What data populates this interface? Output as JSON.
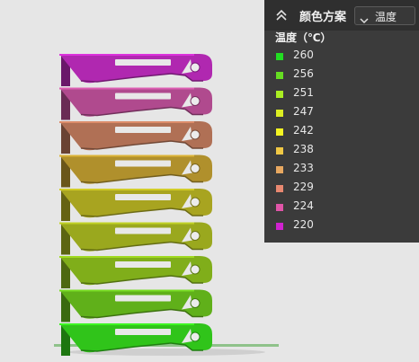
{
  "panel": {
    "title": "颜色方案",
    "collapse_icon": "double-chevron-up-icon",
    "scheme_select": {
      "value": "温度",
      "icon": "chevron-down-icon"
    },
    "legend_heading": "温度（℃）",
    "legend_items": [
      {
        "label": "260",
        "color": "#22dd22"
      },
      {
        "label": "256",
        "color": "#66dd22"
      },
      {
        "label": "251",
        "color": "#aaee22"
      },
      {
        "label": "247",
        "color": "#ddee22"
      },
      {
        "label": "242",
        "color": "#f4f422"
      },
      {
        "label": "238",
        "color": "#f0c844"
      },
      {
        "label": "233",
        "color": "#e8a860"
      },
      {
        "label": "229",
        "color": "#e88870"
      },
      {
        "label": "224",
        "color": "#e055a8"
      },
      {
        "label": "220",
        "color": "#d022d0"
      }
    ]
  },
  "model": {
    "name": "temperature-tower",
    "layer_colors": [
      "#b028b0",
      "#b04a8e",
      "#b07055",
      "#b0902c",
      "#a8a420",
      "#9aa81e",
      "#80ae1a",
      "#60b01a",
      "#30c41a"
    ]
  }
}
